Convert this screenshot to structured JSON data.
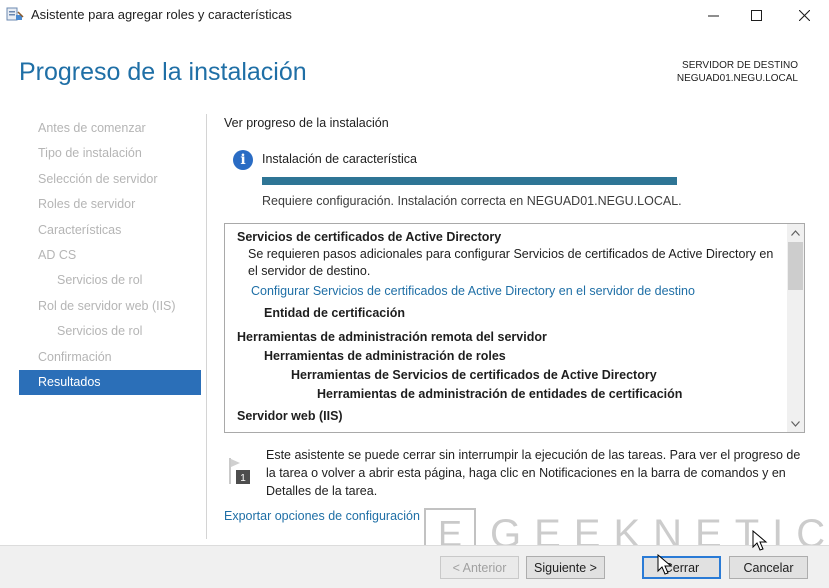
{
  "window": {
    "title": "Asistente para agregar roles y características",
    "icons": {
      "app": "server-manager-icon",
      "minimize": "minimize-icon",
      "maximize": "maximize-icon",
      "close": "close-icon"
    }
  },
  "header": {
    "page_title": "Progreso de la instalación",
    "destination_label": "SERVIDOR DE DESTINO",
    "destination_server": "NEGUAD01.NEGU.LOCAL"
  },
  "nav": {
    "items": [
      {
        "label": "Antes de comenzar",
        "level": 0,
        "active": false
      },
      {
        "label": "Tipo de instalación",
        "level": 0,
        "active": false
      },
      {
        "label": "Selección de servidor",
        "level": 0,
        "active": false
      },
      {
        "label": "Roles de servidor",
        "level": 0,
        "active": false
      },
      {
        "label": "Características",
        "level": 0,
        "active": false
      },
      {
        "label": "AD CS",
        "level": 0,
        "active": false
      },
      {
        "label": "Servicios de rol",
        "level": 1,
        "active": false
      },
      {
        "label": "Rol de servidor web (IIS)",
        "level": 0,
        "active": false
      },
      {
        "label": "Servicios de rol",
        "level": 1,
        "active": false
      },
      {
        "label": "Confirmación",
        "level": 0,
        "active": false
      },
      {
        "label": "Resultados",
        "level": 0,
        "active": true
      }
    ]
  },
  "main": {
    "heading": "Ver progreso de la instalación",
    "feature_label": "Instalación de característica",
    "progress": 1.0,
    "status": "Requiere configuración. Instalación correcta en NEGUAD01.NEGU.LOCAL.",
    "results": [
      {
        "text": "Servicios de certificados de Active Directory",
        "style": "bold",
        "indent": 0
      },
      {
        "text": "Se requieren pasos adicionales para configurar Servicios de certificados de Active Directory en",
        "style": "normal",
        "indent": 1
      },
      {
        "text": "el servidor de destino.",
        "style": "normal",
        "indent": 1
      },
      {
        "text": "Configurar Servicios de certificados de Active Directory en el servidor de destino",
        "style": "link",
        "indent": 1
      },
      {
        "text": "Entidad de certificación",
        "style": "bold",
        "indent": 1
      },
      {
        "text": "Herramientas de administración remota del servidor",
        "style": "bold",
        "indent": 0
      },
      {
        "text": "Herramientas de administración de roles",
        "style": "bold",
        "indent": 1
      },
      {
        "text": "Herramientas de Servicios de certificados de Active Directory",
        "style": "bold",
        "indent": 2
      },
      {
        "text": "Herramientas de administración de entidades de certificación",
        "style": "bold",
        "indent": 3
      },
      {
        "text": "Servidor web (IIS)",
        "style": "bold",
        "indent": 0
      }
    ],
    "note": "Este asistente se puede cerrar sin interrumpir la ejecución de las tareas. Para ver el progreso de la tarea o volver a abrir esta página, haga clic en Notificaciones en la barra de comandos y en Detalles de la tarea.",
    "note_badge": "1",
    "export_link": "Exportar opciones de configuración"
  },
  "footer": {
    "back": "< Anterior",
    "next": "Siguiente >",
    "close": "Cerrar",
    "cancel": "Cancelar"
  },
  "watermark": {
    "text": "GEEKNETIC",
    "box_letter": "E"
  },
  "colors": {
    "accent": "#1f6fa6",
    "nav_active": "#2b6fb8",
    "progress": "#2e7595",
    "info": "#2a6cc4"
  }
}
